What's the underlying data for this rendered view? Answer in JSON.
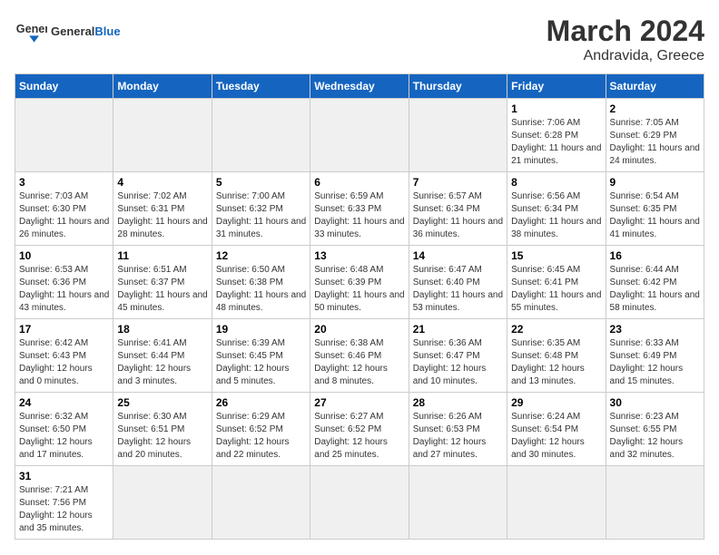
{
  "header": {
    "logo_general": "General",
    "logo_blue": "Blue",
    "title": "March 2024",
    "subtitle": "Andravida, Greece"
  },
  "days_of_week": [
    "Sunday",
    "Monday",
    "Tuesday",
    "Wednesday",
    "Thursday",
    "Friday",
    "Saturday"
  ],
  "weeks": [
    [
      {
        "day": "",
        "info": "",
        "empty": true
      },
      {
        "day": "",
        "info": "",
        "empty": true
      },
      {
        "day": "",
        "info": "",
        "empty": true
      },
      {
        "day": "",
        "info": "",
        "empty": true
      },
      {
        "day": "",
        "info": "",
        "empty": true
      },
      {
        "day": "1",
        "info": "Sunrise: 7:06 AM\nSunset: 6:28 PM\nDaylight: 11 hours and 21 minutes."
      },
      {
        "day": "2",
        "info": "Sunrise: 7:05 AM\nSunset: 6:29 PM\nDaylight: 11 hours and 24 minutes."
      }
    ],
    [
      {
        "day": "3",
        "info": "Sunrise: 7:03 AM\nSunset: 6:30 PM\nDaylight: 11 hours and 26 minutes."
      },
      {
        "day": "4",
        "info": "Sunrise: 7:02 AM\nSunset: 6:31 PM\nDaylight: 11 hours and 28 minutes."
      },
      {
        "day": "5",
        "info": "Sunrise: 7:00 AM\nSunset: 6:32 PM\nDaylight: 11 hours and 31 minutes."
      },
      {
        "day": "6",
        "info": "Sunrise: 6:59 AM\nSunset: 6:33 PM\nDaylight: 11 hours and 33 minutes."
      },
      {
        "day": "7",
        "info": "Sunrise: 6:57 AM\nSunset: 6:34 PM\nDaylight: 11 hours and 36 minutes."
      },
      {
        "day": "8",
        "info": "Sunrise: 6:56 AM\nSunset: 6:34 PM\nDaylight: 11 hours and 38 minutes."
      },
      {
        "day": "9",
        "info": "Sunrise: 6:54 AM\nSunset: 6:35 PM\nDaylight: 11 hours and 41 minutes."
      }
    ],
    [
      {
        "day": "10",
        "info": "Sunrise: 6:53 AM\nSunset: 6:36 PM\nDaylight: 11 hours and 43 minutes."
      },
      {
        "day": "11",
        "info": "Sunrise: 6:51 AM\nSunset: 6:37 PM\nDaylight: 11 hours and 45 minutes."
      },
      {
        "day": "12",
        "info": "Sunrise: 6:50 AM\nSunset: 6:38 PM\nDaylight: 11 hours and 48 minutes."
      },
      {
        "day": "13",
        "info": "Sunrise: 6:48 AM\nSunset: 6:39 PM\nDaylight: 11 hours and 50 minutes."
      },
      {
        "day": "14",
        "info": "Sunrise: 6:47 AM\nSunset: 6:40 PM\nDaylight: 11 hours and 53 minutes."
      },
      {
        "day": "15",
        "info": "Sunrise: 6:45 AM\nSunset: 6:41 PM\nDaylight: 11 hours and 55 minutes."
      },
      {
        "day": "16",
        "info": "Sunrise: 6:44 AM\nSunset: 6:42 PM\nDaylight: 11 hours and 58 minutes."
      }
    ],
    [
      {
        "day": "17",
        "info": "Sunrise: 6:42 AM\nSunset: 6:43 PM\nDaylight: 12 hours and 0 minutes."
      },
      {
        "day": "18",
        "info": "Sunrise: 6:41 AM\nSunset: 6:44 PM\nDaylight: 12 hours and 3 minutes."
      },
      {
        "day": "19",
        "info": "Sunrise: 6:39 AM\nSunset: 6:45 PM\nDaylight: 12 hours and 5 minutes."
      },
      {
        "day": "20",
        "info": "Sunrise: 6:38 AM\nSunset: 6:46 PM\nDaylight: 12 hours and 8 minutes."
      },
      {
        "day": "21",
        "info": "Sunrise: 6:36 AM\nSunset: 6:47 PM\nDaylight: 12 hours and 10 minutes."
      },
      {
        "day": "22",
        "info": "Sunrise: 6:35 AM\nSunset: 6:48 PM\nDaylight: 12 hours and 13 minutes."
      },
      {
        "day": "23",
        "info": "Sunrise: 6:33 AM\nSunset: 6:49 PM\nDaylight: 12 hours and 15 minutes."
      }
    ],
    [
      {
        "day": "24",
        "info": "Sunrise: 6:32 AM\nSunset: 6:50 PM\nDaylight: 12 hours and 17 minutes."
      },
      {
        "day": "25",
        "info": "Sunrise: 6:30 AM\nSunset: 6:51 PM\nDaylight: 12 hours and 20 minutes."
      },
      {
        "day": "26",
        "info": "Sunrise: 6:29 AM\nSunset: 6:52 PM\nDaylight: 12 hours and 22 minutes."
      },
      {
        "day": "27",
        "info": "Sunrise: 6:27 AM\nSunset: 6:52 PM\nDaylight: 12 hours and 25 minutes."
      },
      {
        "day": "28",
        "info": "Sunrise: 6:26 AM\nSunset: 6:53 PM\nDaylight: 12 hours and 27 minutes."
      },
      {
        "day": "29",
        "info": "Sunrise: 6:24 AM\nSunset: 6:54 PM\nDaylight: 12 hours and 30 minutes."
      },
      {
        "day": "30",
        "info": "Sunrise: 6:23 AM\nSunset: 6:55 PM\nDaylight: 12 hours and 32 minutes."
      }
    ],
    [
      {
        "day": "31",
        "info": "Sunrise: 7:21 AM\nSunset: 7:56 PM\nDaylight: 12 hours and 35 minutes."
      },
      {
        "day": "",
        "info": "",
        "empty": true
      },
      {
        "day": "",
        "info": "",
        "empty": true
      },
      {
        "day": "",
        "info": "",
        "empty": true
      },
      {
        "day": "",
        "info": "",
        "empty": true
      },
      {
        "day": "",
        "info": "",
        "empty": true
      },
      {
        "day": "",
        "info": "",
        "empty": true
      }
    ]
  ]
}
